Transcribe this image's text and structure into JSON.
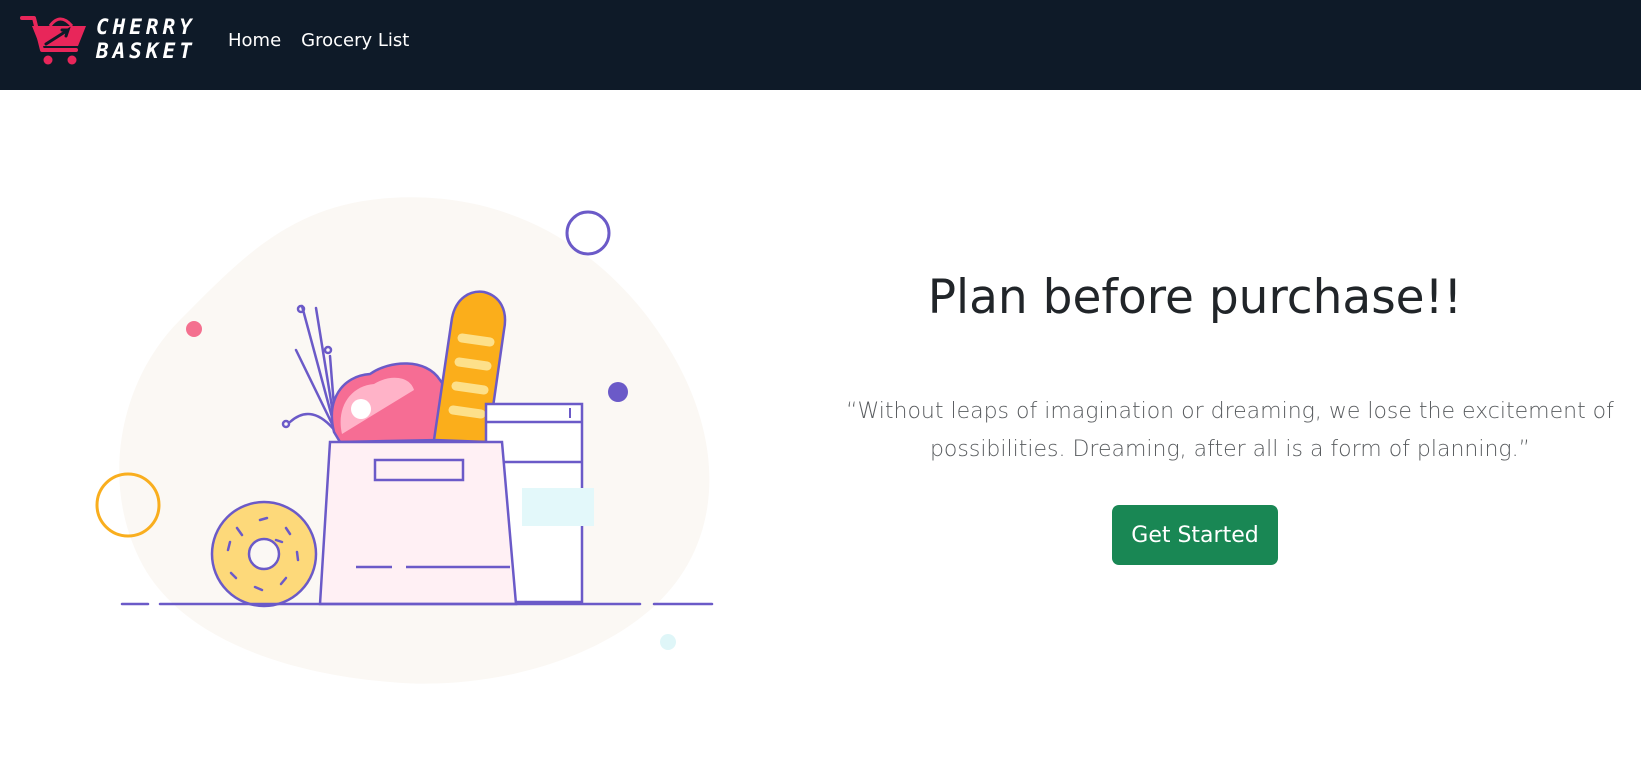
{
  "brand": {
    "line1": "CHERRY",
    "line2": "BASKET",
    "logo_icon": "shopping-cart-icon"
  },
  "nav": {
    "items": [
      {
        "label": "Home"
      },
      {
        "label": "Grocery List"
      }
    ]
  },
  "hero": {
    "title": "Plan before purchase!!",
    "quote": "“Without leaps of imagination or dreaming, we lose the excitement of possibilities. Dreaming, after all is a form of planning.”",
    "cta_label": "Get Started"
  },
  "colors": {
    "navbar_bg": "#0e1a28",
    "cta_bg": "#198754",
    "brand_accent": "#e8265a",
    "illustration_line": "#6b5ac8"
  }
}
